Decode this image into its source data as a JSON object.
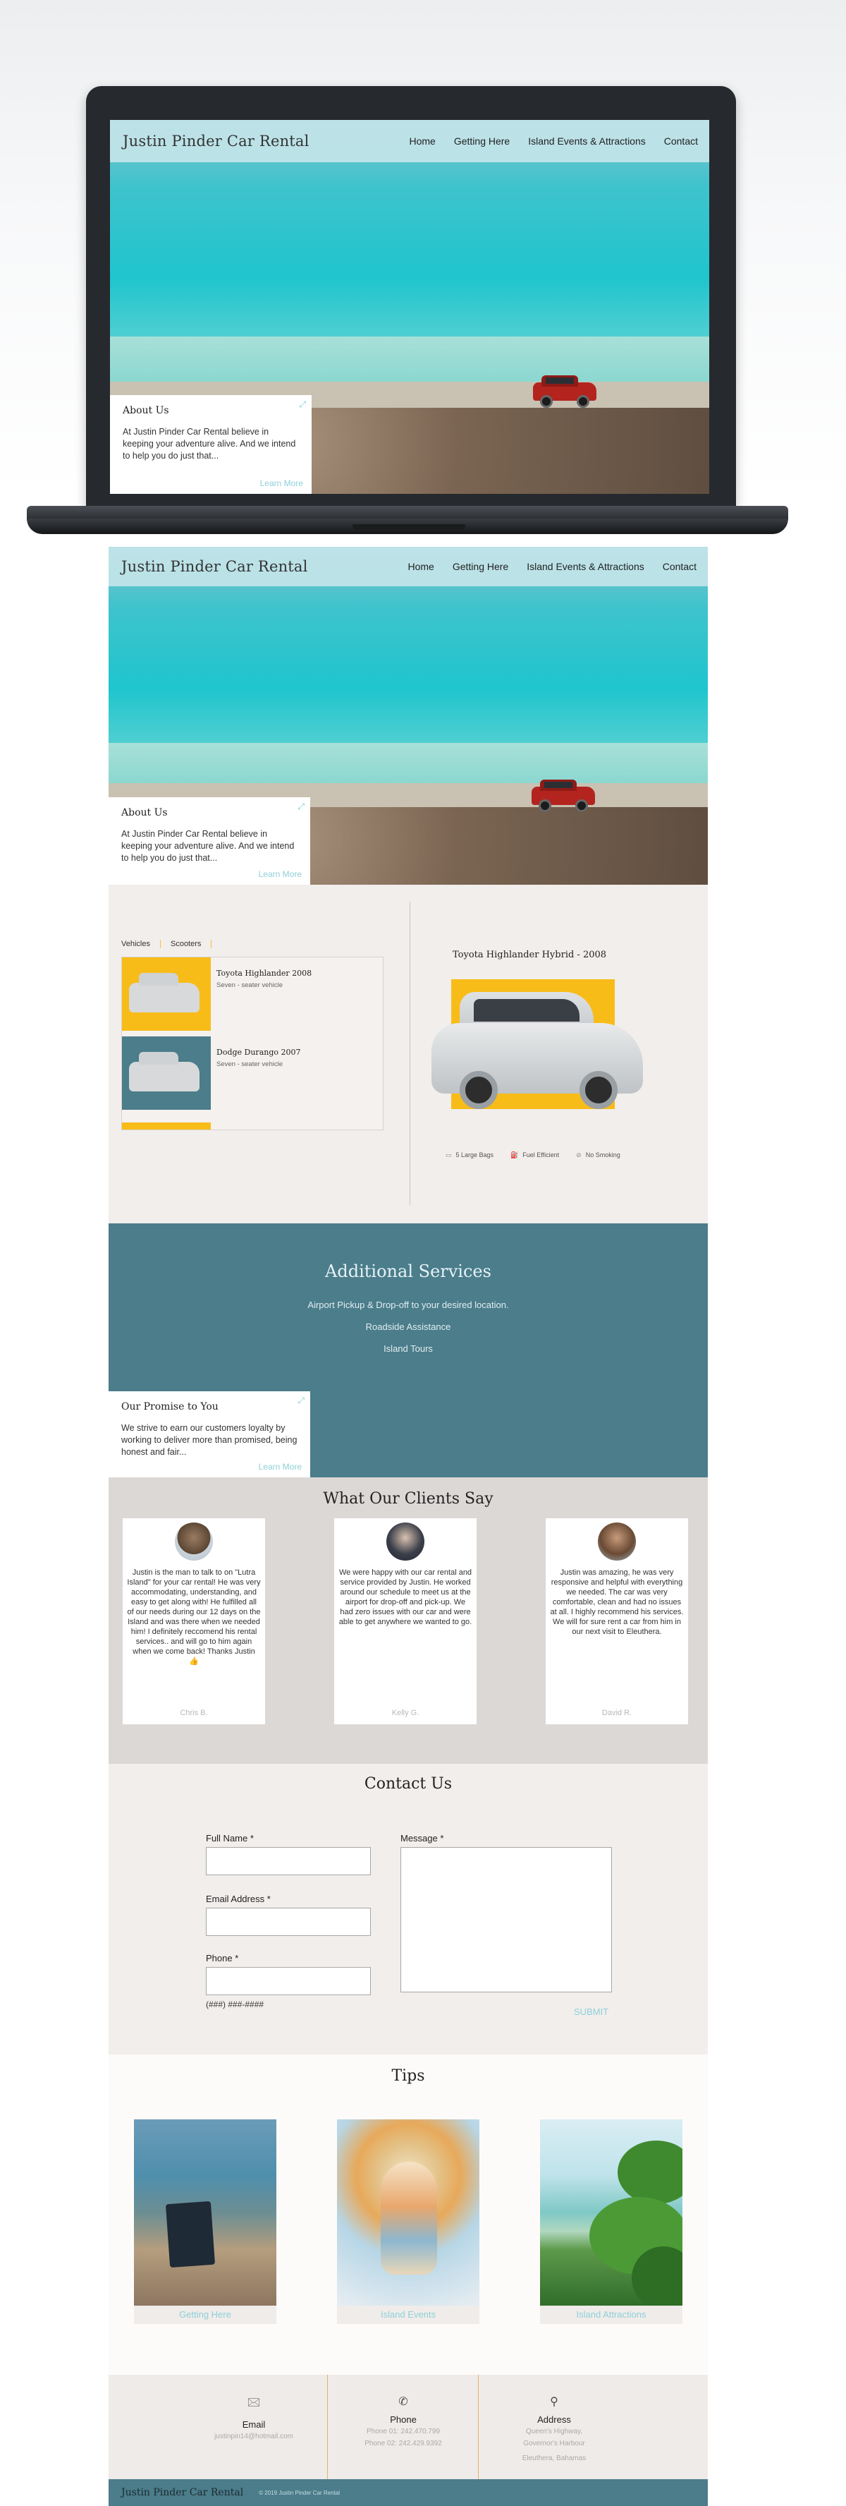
{
  "site": {
    "brand": "Justin Pinder Car Rental",
    "nav": [
      "Home",
      "Getting Here",
      "Island Events & Attractions",
      "Contact"
    ]
  },
  "about": {
    "title": "About Us",
    "text": "At Justin Pinder Car Rental believe in keeping your adventure alive. And we intend to help you do just that...",
    "more": "Learn More"
  },
  "vehicles": {
    "tabs": [
      "Vehicles",
      "Scooters"
    ],
    "items": [
      {
        "name": "Toyota Highlander 2008",
        "sub": "Seven - seater vehicle"
      },
      {
        "name": "Dodge Durango 2007",
        "sub": "Seven - seater vehicle"
      }
    ],
    "selected_title": "Toyota Highlander Hybrid - 2008",
    "features": [
      {
        "icon": "suitcase-icon",
        "label": "5 Large Bags"
      },
      {
        "icon": "fuel-icon",
        "label": "Fuel Efficient"
      },
      {
        "icon": "no-smoking-icon",
        "label": "No Smoking"
      }
    ]
  },
  "services": {
    "title": "Additional Services",
    "items": [
      "Airport Pickup & Drop-off to your desired location.",
      "Roadside Assistance",
      "Island Tours"
    ]
  },
  "promise": {
    "title": "Our Promise to You",
    "text": "We strive to earn our customers loyalty by working to deliver more than promised, being honest and fair...",
    "more": "Learn More"
  },
  "testimonials": {
    "title": "What Our Clients Say",
    "items": [
      {
        "text": "Justin is the man to talk to on \"Lutra Island\" for your car rental! He was very accommodating, understanding, and easy to get along with! He fulfilled all of our needs during our 12 days on the Island and was there when we needed him! I definitely reccomend his rental services.. and will go to him again when we come back! Thanks Justin 👍",
        "name": "Chris B."
      },
      {
        "text": "We were happy with our car rental and service provided by Justin. He worked around our schedule to meet us at the airport for drop-off and pick-up. We had zero issues with our car and were able to get anywhere we wanted to go.",
        "name": "Kelly G."
      },
      {
        "text": "Justin was amazing, he was very responsive and helpful with everything we needed. The car was very comfortable, clean and had no issues at all. I highly recommend his services. We will for sure rent a car from him in our next visit to Eleuthera.",
        "name": "David R."
      }
    ]
  },
  "contact": {
    "title": "Contact Us",
    "full_name_label": "Full Name *",
    "email_label": "Email Address *",
    "phone_label": "Phone *",
    "message_label": "Message *",
    "phone_format": "(###) ###-####",
    "submit": "SUBMIT"
  },
  "tips": {
    "title": "Tips",
    "items": [
      "Getting Here",
      "Island Events",
      "Island Attractions"
    ]
  },
  "info": {
    "email": {
      "title": "Email",
      "value": "justinpin14@hotmail.com"
    },
    "phone": {
      "title": "Phone",
      "line1": "Phone 01: 242.470.799",
      "line2": "Phone 02: 242.429.9392"
    },
    "address": {
      "title": "Address",
      "line1": "Queen's Highway,",
      "line2": "Governor's Harbour",
      "line3": "Eleuthera, Bahamas"
    }
  },
  "footer": {
    "brand": "Justin Pinder Car Rental",
    "copyright": "© 2019 Justin Pinder Car Rental"
  },
  "colors": {
    "teal": "#4b7d8b",
    "yellow": "#f8bc19",
    "link": "#8ed0d8"
  }
}
